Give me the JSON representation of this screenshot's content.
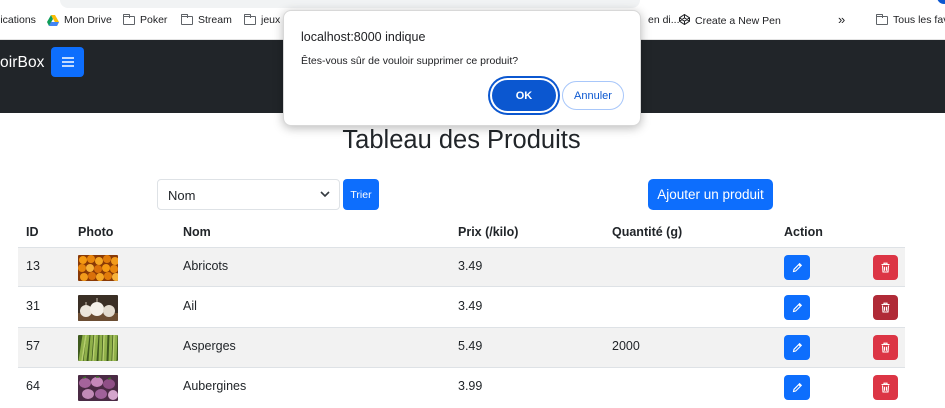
{
  "bookmarks": {
    "items": [
      {
        "label": "lications",
        "icon": "apps-icon"
      },
      {
        "label": "Mon Drive",
        "icon": "drive-icon"
      },
      {
        "label": "Poker",
        "icon": "folder-icon"
      },
      {
        "label": "Stream",
        "icon": "folder-icon"
      },
      {
        "label": "jeux",
        "icon": "folder-icon"
      },
      {
        "label": "en di...",
        "icon": "page-icon"
      },
      {
        "label": "Create a New Pen",
        "icon": "codepen-icon"
      },
      {
        "label": "»",
        "icon": "overflow-icon"
      },
      {
        "label": "Tous les favo",
        "icon": "folder-icon"
      }
    ]
  },
  "navbar": {
    "brand": "oirBox",
    "toggle_icon": "hamburger-icon",
    "background": "#212529"
  },
  "page": {
    "title": "Tableau des Produits"
  },
  "controls": {
    "sort_select_value": "Nom",
    "sort_button_label": "Trier",
    "add_button_label": "Ajouter un produit",
    "accent": "#0d6efd",
    "danger": "#dc3545"
  },
  "table": {
    "headers": [
      "ID",
      "Photo",
      "Nom",
      "Prix (/kilo)",
      "Quantité (g)",
      "Action"
    ],
    "rows": [
      {
        "id": "13",
        "name": "Abricots",
        "price": "3.49",
        "quantity": "",
        "photo": "apricots"
      },
      {
        "id": "31",
        "name": "Ail",
        "price": "3.49",
        "quantity": "",
        "photo": "garlic"
      },
      {
        "id": "57",
        "name": "Asperges",
        "price": "5.49",
        "quantity": "2000",
        "photo": "asparagus"
      },
      {
        "id": "64",
        "name": "Aubergines",
        "price": "3.99",
        "quantity": "",
        "photo": "eggplants"
      }
    ]
  },
  "dialog": {
    "title": "localhost:8000 indique",
    "message": "Êtes-vous sûr de vouloir supprimer ce produit?",
    "ok_label": "OK",
    "cancel_label": "Annuler",
    "accent": "#0b57d0"
  }
}
